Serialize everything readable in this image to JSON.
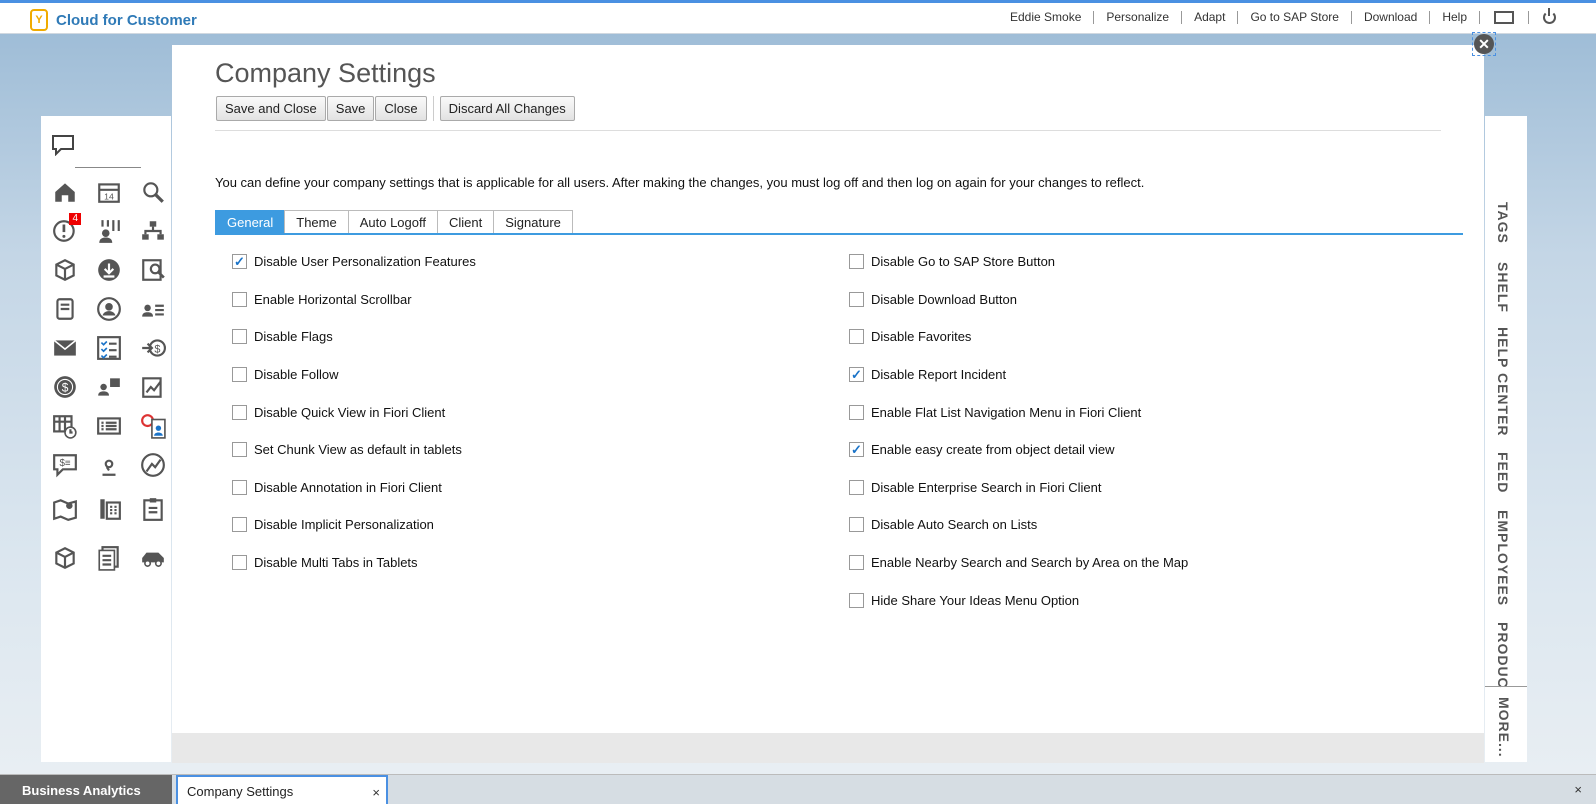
{
  "app": {
    "brand_logo": "Y",
    "brand_name": "Cloud for Customer"
  },
  "topnav": {
    "user": "Eddie Smoke",
    "links": [
      "Personalize",
      "Adapt",
      "Go to SAP Store",
      "Download",
      "Help"
    ],
    "icons": [
      "screen-icon",
      "power-icon"
    ]
  },
  "launchpad": {
    "top_icon": "chat-bubble-icon",
    "badge": "4",
    "icons": [
      "home-icon",
      "calendar-icon",
      "search-icon",
      "alert-icon",
      "team-icon",
      "org-chart-icon",
      "product-icon",
      "download-icon",
      "report-icon",
      "notebook-icon",
      "contact-icon",
      "people-list-icon",
      "mail-icon",
      "checklist-icon",
      "payment-icon",
      "dollar-icon",
      "user-chart-icon",
      "edit-chart-icon",
      "calendar-grid-icon",
      "list-icon",
      "timesheet-icon",
      "chat-dollar-icon",
      "map-pin-icon",
      "route-icon",
      "map-icon",
      "phone-icon",
      "clipboard-icon",
      "box-icon",
      "documents-icon",
      "car-icon"
    ]
  },
  "sidebar": {
    "tabs": [
      "TAGS",
      "SHELF",
      "HELP CENTER",
      "FEED",
      "EMPLOYEES",
      "PRODUC"
    ],
    "more": "MORE..."
  },
  "dialog": {
    "title": "Company Settings",
    "buttons": {
      "save_and_close": "Save and Close",
      "save": "Save",
      "close": "Close",
      "discard": "Discard All Changes"
    },
    "description": "You can define your company settings that is applicable for all users. After making the changes, you must log off and then log on again for your changes to reflect.",
    "tabs": [
      "General",
      "Theme",
      "Auto Logoff",
      "Client",
      "Signature"
    ],
    "active_tab": "General",
    "left_options": [
      {
        "label": "Disable User Personalization Features",
        "checked": true
      },
      {
        "label": "Enable Horizontal Scrollbar",
        "checked": false
      },
      {
        "label": "Disable Flags",
        "checked": false
      },
      {
        "label": "Disable Follow",
        "checked": false
      },
      {
        "label": "Disable Quick View in Fiori Client",
        "checked": false
      },
      {
        "label": "Set Chunk View as default in tablets",
        "checked": false
      },
      {
        "label": "Disable Annotation in Fiori Client",
        "checked": false
      },
      {
        "label": "Disable Implicit Personalization",
        "checked": false
      },
      {
        "label": "Disable Multi Tabs in Tablets",
        "checked": false
      }
    ],
    "right_options": [
      {
        "label": "Disable Go to SAP Store Button",
        "checked": false
      },
      {
        "label": "Disable Download Button",
        "checked": false
      },
      {
        "label": "Disable Favorites",
        "checked": false
      },
      {
        "label": "Disable Report Incident",
        "checked": true
      },
      {
        "label": "Enable Flat List Navigation Menu in Fiori Client",
        "checked": false
      },
      {
        "label": "Enable easy create from object detail view",
        "checked": true
      },
      {
        "label": "Disable Enterprise Search in Fiori Client",
        "checked": false
      },
      {
        "label": "Disable Auto Search on Lists",
        "checked": false
      },
      {
        "label": "Enable Nearby Search and Search by Area on the Map",
        "checked": false
      },
      {
        "label": "Hide Share Your Ideas Menu Option",
        "checked": false
      }
    ]
  },
  "bottom_tabs": {
    "analytics": "Business Analytics",
    "current": "Company Settings",
    "close_glyph": "×"
  },
  "colors": {
    "accent": "#3d9be0",
    "brand": "#2f7ab7",
    "logo": "#f0ab00",
    "badge": "#ee0000"
  }
}
